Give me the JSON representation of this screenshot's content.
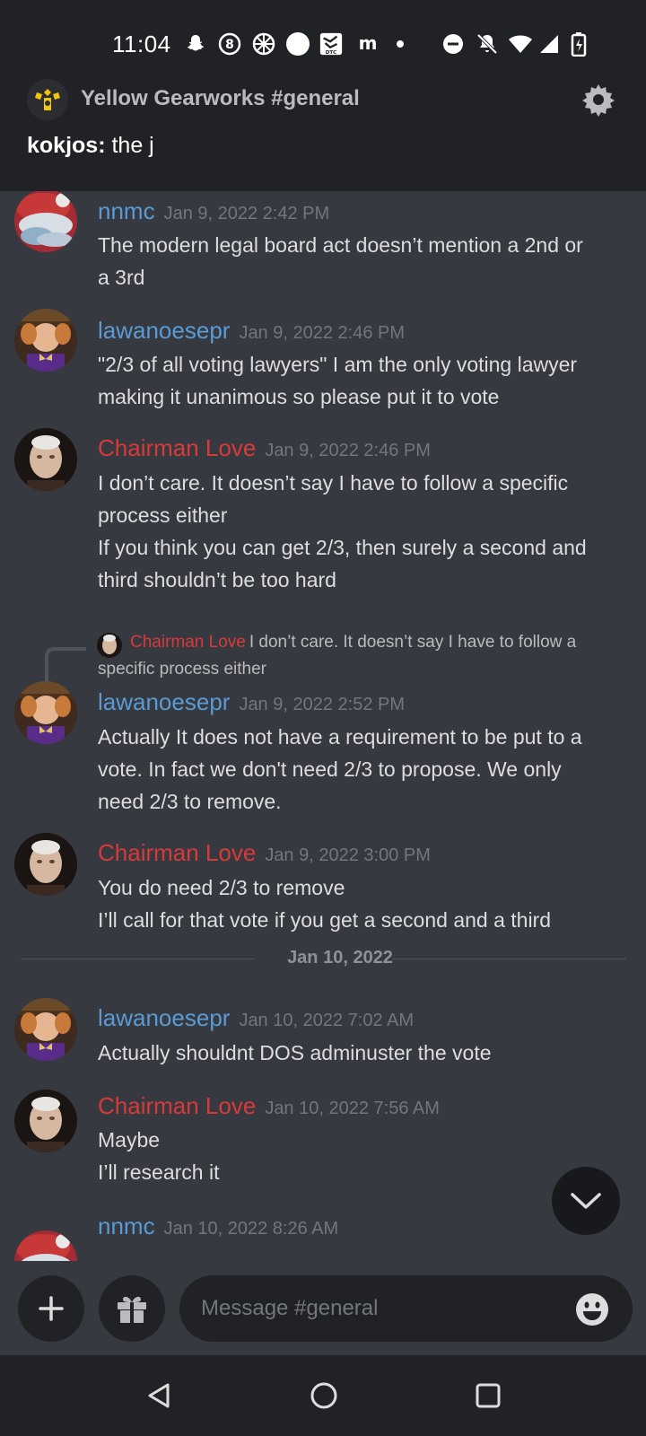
{
  "status_bar": {
    "time": "11:04"
  },
  "header": {
    "server_name": "Yellow Gearworks",
    "channel": "#general",
    "server_channel": "Yellow Gearworks #general",
    "preview_author": "kokjos:",
    "preview_text": " the j"
  },
  "messages": [
    {
      "author": "nnmc",
      "timestamp": "Jan 9, 2022 2:42 PM",
      "lines": [
        "The modern legal board act doesn’t mention a 2nd or",
        "a 3rd"
      ]
    },
    {
      "author": "lawanoesepr",
      "timestamp": "Jan 9, 2022 2:46 PM",
      "lines": [
        "\"2/3 of all voting lawyers\" I am the only voting lawyer",
        "making it unanimous so please put it to vote"
      ]
    },
    {
      "author": "Chairman Love",
      "timestamp": "Jan 9, 2022 2:46 PM",
      "lines": [
        "I don’t care. It doesn’t say I have to follow a specific",
        "process either",
        "If you think you can get 2/3, then surely a second and",
        "third shouldn’t be too hard"
      ]
    },
    {
      "author": "lawanoesepr",
      "timestamp": "Jan 9, 2022 2:52 PM",
      "lines": [
        "Actually It does not have a requirement to be put to a",
        "vote. In fact we don't need 2/3 to propose. We only",
        "need 2/3 to remove."
      ]
    },
    {
      "author": "Chairman Love",
      "timestamp": "Jan 9, 2022 3:00 PM",
      "lines": [
        "You do need 2/3 to remove",
        "I’ll call for that vote if you get a second and a third"
      ]
    },
    {
      "author": "lawanoesepr",
      "timestamp": "Jan 10, 2022 7:02 AM",
      "lines": [
        "Actually shouldnt DOS adminuster the vote"
      ]
    },
    {
      "author": "Chairman Love",
      "timestamp": "Jan 10, 2022 7:56 AM",
      "lines": [
        "Maybe",
        "I’ll research it"
      ]
    },
    {
      "author": "nnmc",
      "timestamp": "Jan 10, 2022 8:26 AM",
      "lines": []
    }
  ],
  "reply": {
    "author": "Chairman Love",
    "text": "I don’t care. It doesn’t say I have to follow a specific process either"
  },
  "date_divider": "Jan 10, 2022",
  "composer": {
    "placeholder": "Message #general"
  },
  "colors": {
    "username_blue": "#5b9bd5",
    "username_red": "#d83a3a",
    "background": "#36393f",
    "header_bg": "#202225"
  }
}
